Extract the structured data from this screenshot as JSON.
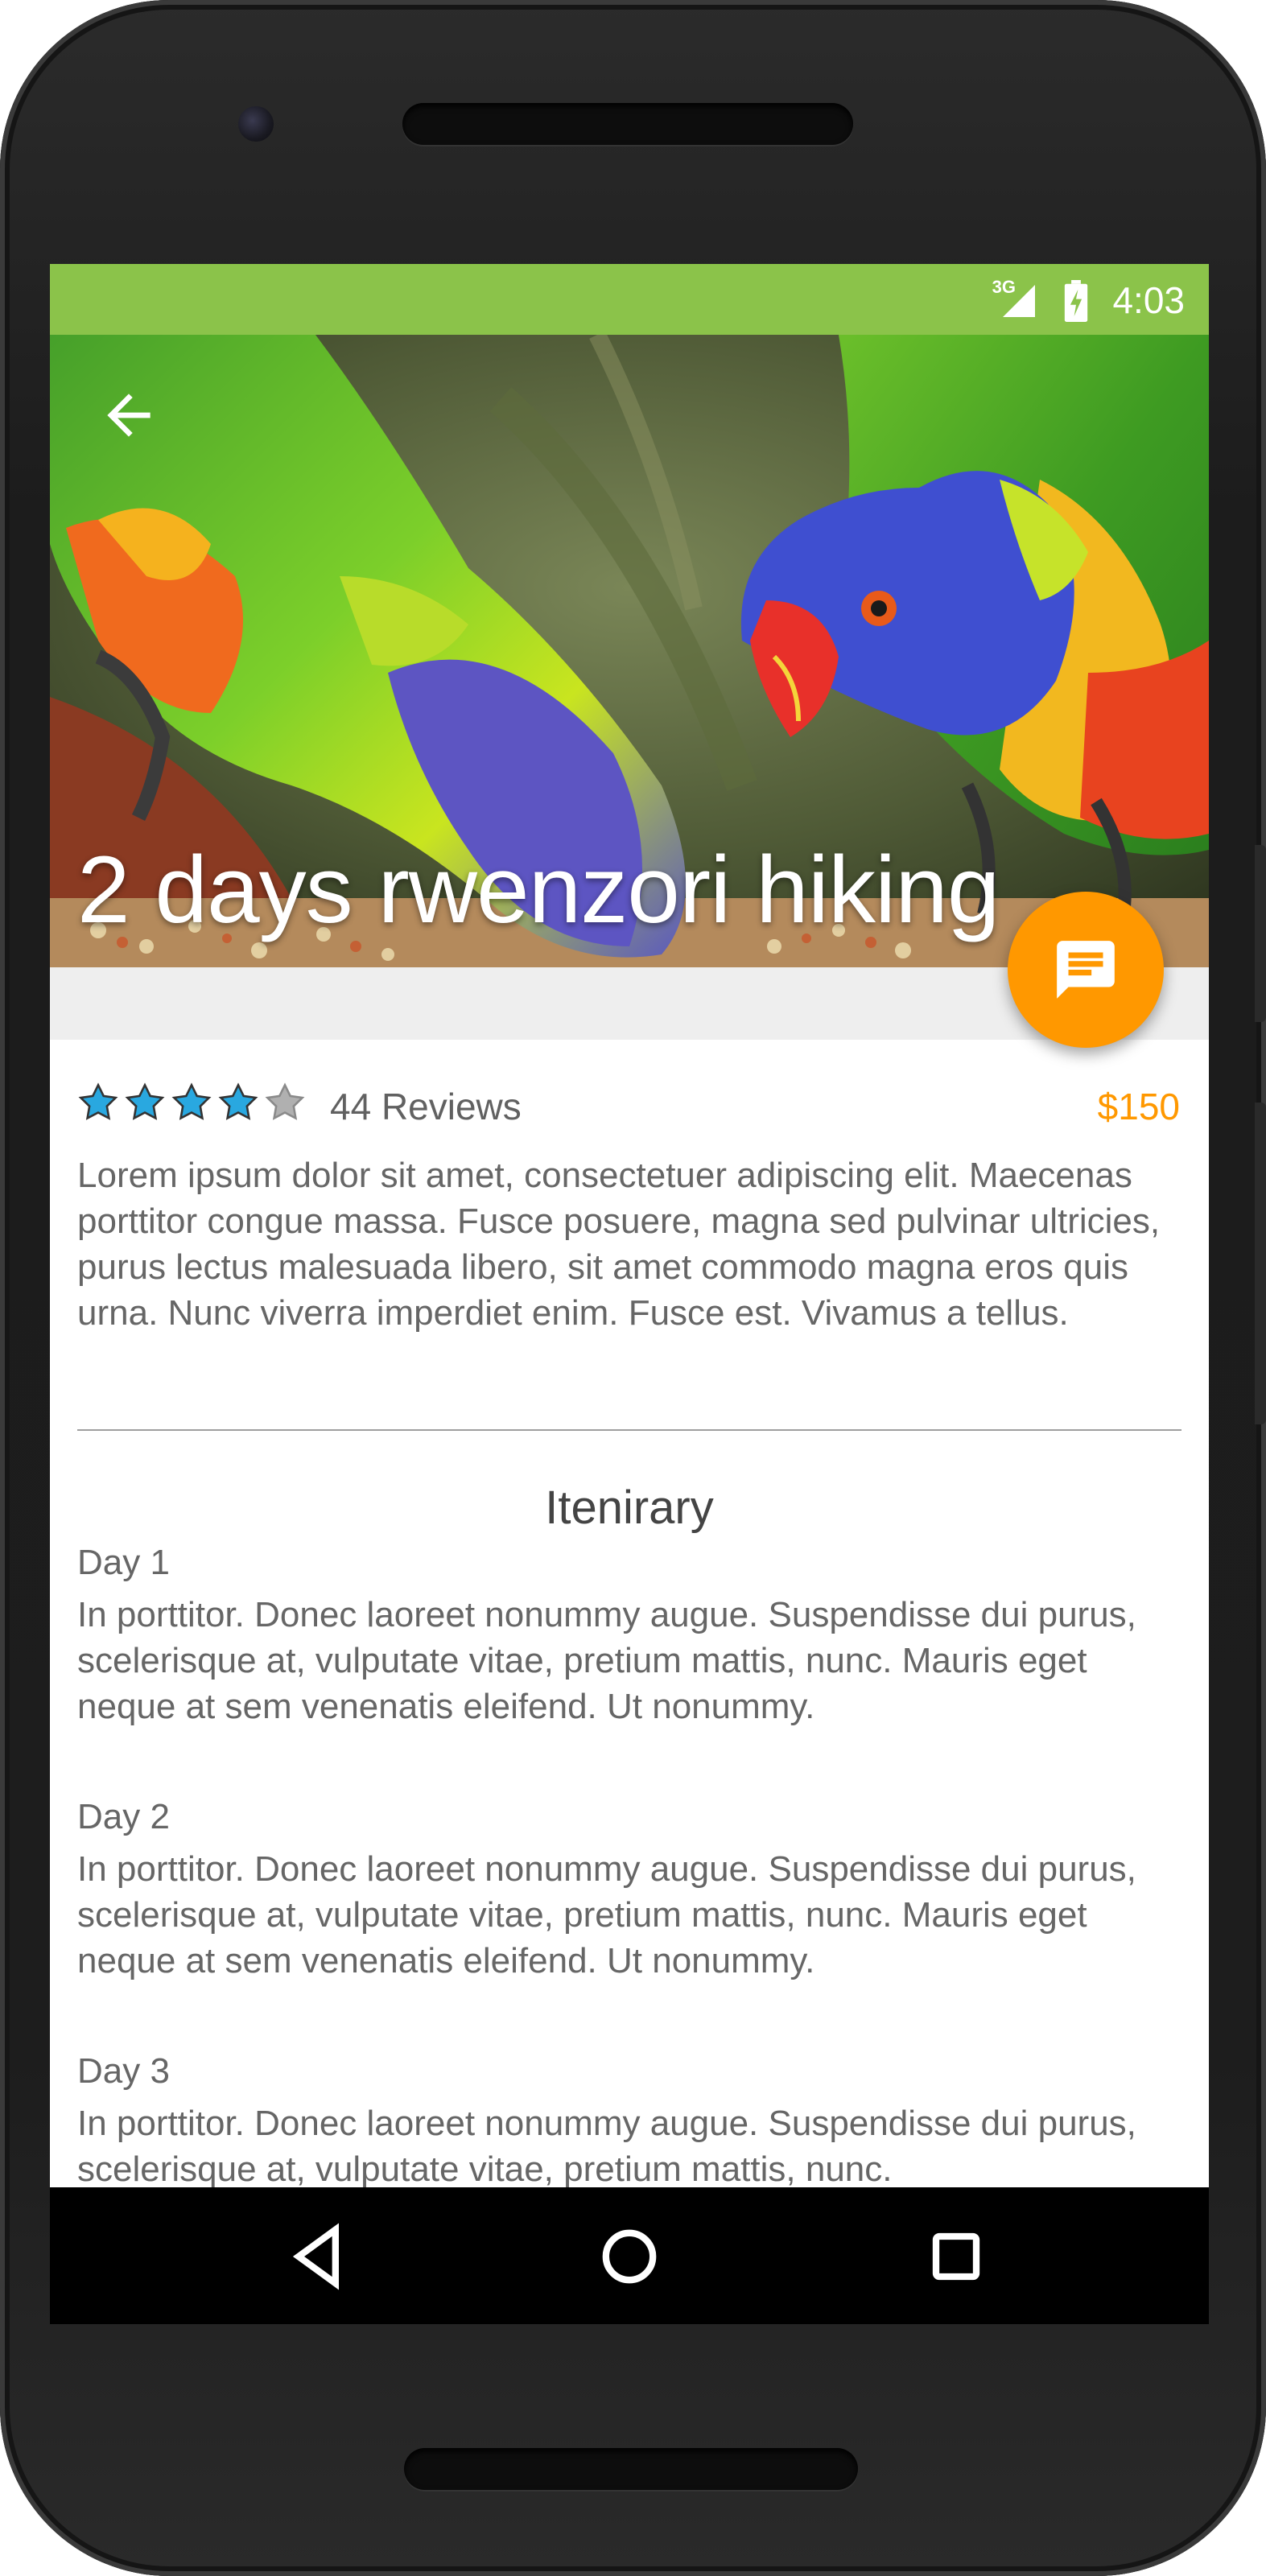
{
  "status_bar": {
    "network": "3G",
    "time": "4:03",
    "color": "#8bc34a"
  },
  "hero": {
    "title": "2 days rwenzori hiking",
    "back_icon": "arrow-back-icon"
  },
  "fab": {
    "icon": "message-icon",
    "color": "#ff9800"
  },
  "rating": {
    "stars": 4,
    "max_stars": 5,
    "reviews": "44 Reviews",
    "price": "$150"
  },
  "description": "Lorem ipsum dolor sit amet, consectetuer adipiscing elit. Maecenas porttitor congue massa. Fusce posuere, magna sed pulvinar ultricies, purus lectus malesuada libero, sit amet commodo magna eros quis urna. Nunc viverra imperdiet enim. Fusce est. Vivamus a tellus.",
  "itinerary": {
    "title": "Itenirary",
    "days": [
      {
        "label": "Day 1",
        "text": "In porttitor. Donec laoreet nonummy augue. Suspendisse dui purus, scelerisque at, vulputate vitae, pretium mattis, nunc. Mauris eget neque at sem venenatis eleifend. Ut nonummy."
      },
      {
        "label": "Day 2",
        "text": "In porttitor. Donec laoreet nonummy augue. Suspendisse dui purus, scelerisque at, vulputate vitae, pretium mattis, nunc. Mauris eget neque at sem venenatis eleifend. Ut nonummy."
      },
      {
        "label": "Day 3",
        "text": "In porttitor. Donec laoreet nonummy augue. Suspendisse dui purus, scelerisque at, vulputate vitae, pretium mattis, nunc."
      }
    ]
  },
  "nav_bar": {
    "back": "nav-back-icon",
    "home": "nav-home-icon",
    "recents": "nav-recents-icon"
  }
}
